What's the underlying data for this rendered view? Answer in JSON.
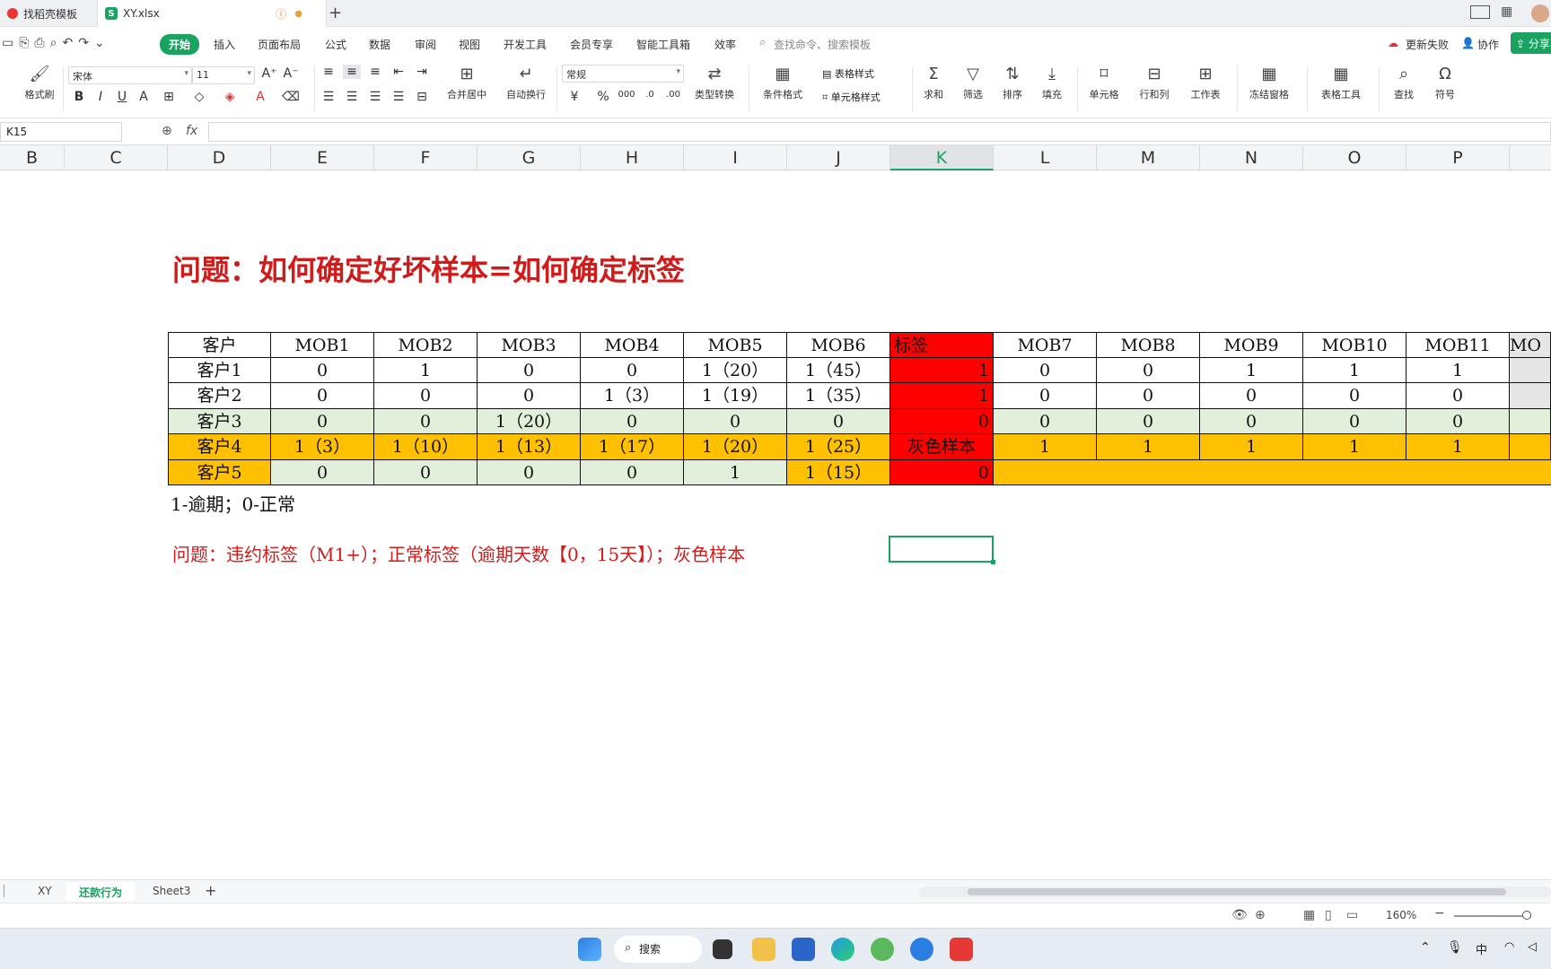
{
  "tabs": [
    {
      "label": "找稻壳模板"
    },
    {
      "label": "XY.xlsx"
    }
  ],
  "menu": [
    "开始",
    "插入",
    "页面布局",
    "公式",
    "数据",
    "审阅",
    "视图",
    "开发工具",
    "会员专享",
    "智能工具箱",
    "效率"
  ],
  "search_placeholder": "查找命令、搜索模板",
  "top_right": {
    "update": "更新失败",
    "collab": "协作",
    "share": "分享"
  },
  "ribbon": {
    "format_painter": "格式刷",
    "font_name": "宋体",
    "font_size": "11",
    "merge_center": "合并居中",
    "wrap_text": "自动换行",
    "number_format": "常规",
    "type_convert": "类型转换",
    "cond_format": "条件格式",
    "table_style": "表格样式",
    "cell_style": "单元格样式",
    "sum": "求和",
    "filter": "筛选",
    "sort": "排序",
    "fill": "填充",
    "cell": "单元格",
    "row_col": "行和列",
    "worksheet": "工作表",
    "freeze": "冻结窗格",
    "table_tools": "表格工具",
    "find": "查找",
    "symbol": "符号"
  },
  "namebox": "K15",
  "fx": "fx",
  "columns": [
    "B",
    "C",
    "D",
    "E",
    "F",
    "G",
    "H",
    "I",
    "J",
    "K",
    "L",
    "M",
    "N",
    "O",
    "P"
  ],
  "selected_column": "K",
  "title": "问题：如何确定好坏样本=如何确定标签",
  "table": {
    "header": [
      "客户",
      "MOB1",
      "MOB2",
      "MOB3",
      "MOB4",
      "MOB5",
      "MOB6",
      "标签",
      "MOB7",
      "MOB8",
      "MOB9",
      "MOB10",
      "MOB11",
      "MO"
    ],
    "rows": [
      [
        "客户1",
        "0",
        "1",
        "0",
        "0",
        "1（20）",
        "1（45）",
        "1",
        "0",
        "0",
        "1",
        "1",
        "1",
        ""
      ],
      [
        "客户2",
        "0",
        "0",
        "0",
        "1（3）",
        "1（19）",
        "1（35）",
        "1",
        "0",
        "0",
        "0",
        "0",
        "0",
        ""
      ],
      [
        "客户3",
        "0",
        "0",
        "1（20）",
        "0",
        "0",
        "0",
        "0",
        "0",
        "0",
        "0",
        "0",
        "0",
        ""
      ],
      [
        "客户4",
        "1（3）",
        "1（10）",
        "1（13）",
        "1（17）",
        "1（20）",
        "1（25）",
        "灰色样本",
        "1",
        "1",
        "1",
        "1",
        "1",
        ""
      ],
      [
        "客户5",
        "0",
        "0",
        "0",
        "0",
        "1",
        "1（15）",
        "0",
        "",
        "",
        "",
        "",
        "",
        ""
      ]
    ]
  },
  "note1": "1-逾期；0-正常",
  "note2": "问题：违约标签（M1+）；正常标签（逾期天数【0，15天】）；灰色样本",
  "sheets": [
    "XY",
    "还款行为",
    "Sheet3"
  ],
  "active_sheet": "还款行为",
  "zoom": "160%",
  "taskbar": {
    "search": "搜索",
    "ime": "中"
  },
  "colors": {
    "accent": "#1aa260",
    "red": "#ff0000",
    "orange": "#ffc000",
    "green_fill": "#e2efda",
    "title_red": "#d11a1a"
  }
}
